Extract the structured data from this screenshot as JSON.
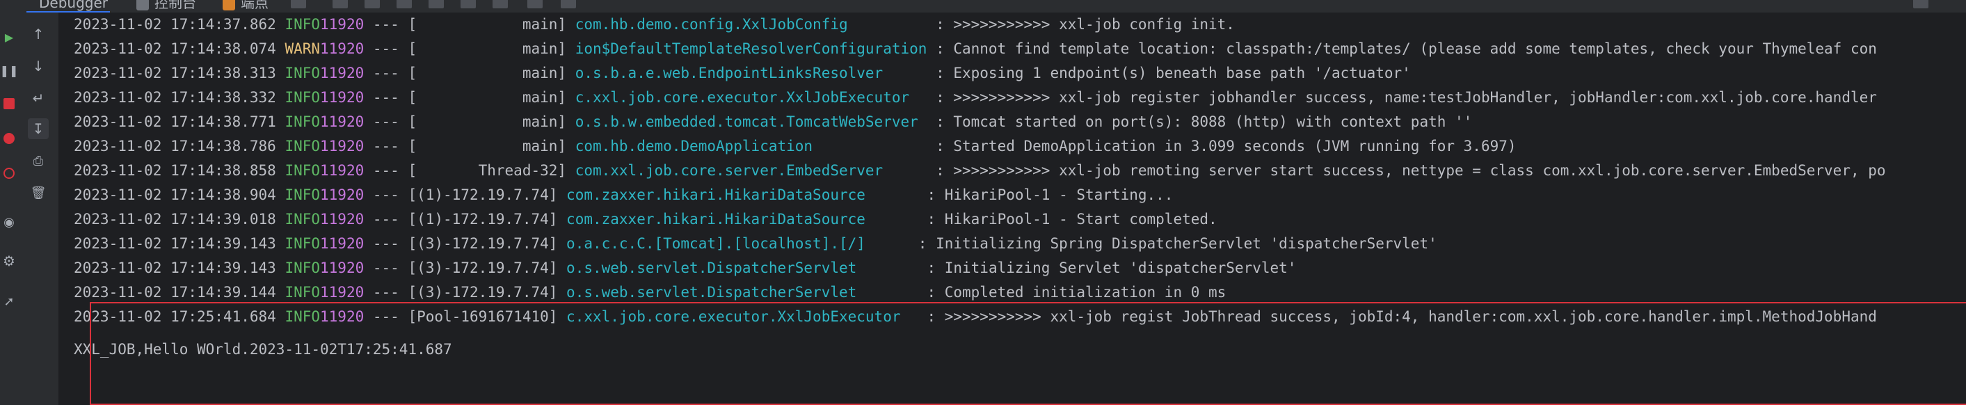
{
  "tabs": [
    {
      "label": "Debugger"
    },
    {
      "label": "控制台"
    },
    {
      "label": "端点"
    }
  ],
  "colors": {
    "info": "#5fb865",
    "warn": "#e5c07b",
    "pid": "#c678dd",
    "logger": "#2fb5c4",
    "highlight_border": "#d8323c"
  },
  "console": {
    "lines": [
      {
        "ts": "2023-11-02 17:14:37.862",
        "level": " INFO",
        "pid": "11920",
        "dash": " --- ",
        "thread": "[            main]",
        "logger": "com.hb.demo.config.XxlJobConfig         ",
        "msg": ": >>>>>>>>>>> xxl-job config init."
      },
      {
        "ts": "2023-11-02 17:14:38.074",
        "level": " WARN",
        "pid": "11920",
        "dash": " --- ",
        "thread": "[            main]",
        "logger": "ion$DefaultTemplateResolverConfiguration",
        "msg": ": Cannot find template location: classpath:/templates/ (please add some templates, check your Thymeleaf con"
      },
      {
        "ts": "2023-11-02 17:14:38.313",
        "level": " INFO",
        "pid": "11920",
        "dash": " --- ",
        "thread": "[            main]",
        "logger": "o.s.b.a.e.web.EndpointLinksResolver     ",
        "msg": ": Exposing 1 endpoint(s) beneath base path '/actuator'"
      },
      {
        "ts": "2023-11-02 17:14:38.332",
        "level": " INFO",
        "pid": "11920",
        "dash": " --- ",
        "thread": "[            main]",
        "logger": "c.xxl.job.core.executor.XxlJobExecutor  ",
        "msg": ": >>>>>>>>>>> xxl-job register jobhandler success, name:testJobHandler, jobHandler:com.xxl.job.core.handler"
      },
      {
        "ts": "2023-11-02 17:14:38.771",
        "level": " INFO",
        "pid": "11920",
        "dash": " --- ",
        "thread": "[            main]",
        "logger": "o.s.b.w.embedded.tomcat.TomcatWebServer ",
        "msg": ": Tomcat started on port(s): 8088 (http) with context path ''"
      },
      {
        "ts": "2023-11-02 17:14:38.786",
        "level": " INFO",
        "pid": "11920",
        "dash": " --- ",
        "thread": "[            main]",
        "logger": "com.hb.demo.DemoApplication             ",
        "msg": ": Started DemoApplication in 3.099 seconds (JVM running for 3.697)"
      },
      {
        "ts": "2023-11-02 17:14:38.858",
        "level": " INFO",
        "pid": "11920",
        "dash": " --- ",
        "thread": "[       Thread-32]",
        "logger": "com.xxl.job.core.server.EmbedServer     ",
        "msg": ": >>>>>>>>>>> xxl-job remoting server start success, nettype = class com.xxl.job.core.server.EmbedServer, po"
      },
      {
        "ts": "2023-11-02 17:14:38.904",
        "level": " INFO",
        "pid": "11920",
        "dash": " --- ",
        "thread": "[(1)-172.19.7.74]",
        "logger": "com.zaxxer.hikari.HikariDataSource      ",
        "msg": ": HikariPool-1 - Starting..."
      },
      {
        "ts": "2023-11-02 17:14:39.018",
        "level": " INFO",
        "pid": "11920",
        "dash": " --- ",
        "thread": "[(1)-172.19.7.74]",
        "logger": "com.zaxxer.hikari.HikariDataSource      ",
        "msg": ": HikariPool-1 - Start completed."
      },
      {
        "ts": "2023-11-02 17:14:39.143",
        "level": " INFO",
        "pid": "11920",
        "dash": " --- ",
        "thread": "[(3)-172.19.7.74]",
        "logger": "o.a.c.c.C.[Tomcat].[localhost].[/]     ",
        "msg": ": Initializing Spring DispatcherServlet 'dispatcherServlet'"
      },
      {
        "ts": "2023-11-02 17:14:39.143",
        "level": " INFO",
        "pid": "11920",
        "dash": " --- ",
        "thread": "[(3)-172.19.7.74]",
        "logger": "o.s.web.servlet.DispatcherServlet       ",
        "msg": ": Initializing Servlet 'dispatcherServlet'"
      },
      {
        "ts": "2023-11-02 17:14:39.144",
        "level": " INFO",
        "pid": "11920",
        "dash": " --- ",
        "thread": "[(3)-172.19.7.74]",
        "logger": "o.s.web.servlet.DispatcherServlet       ",
        "msg": ": Completed initialization in 0 ms"
      },
      {
        "ts": "2023-11-02 17:25:41.684",
        "level": " INFO",
        "pid": "11920",
        "dash": " --- ",
        "thread": "[Pool-1691671410]",
        "logger": "c.xxl.job.core.executor.XxlJobExecutor  ",
        "msg": ": >>>>>>>>>>> xxl-job regist JobThread success, jobId:4, handler:com.xxl.job.core.handler.impl.MethodJobHand"
      }
    ],
    "plain_line": "XXL_JOB,Hello WOrld.2023-11-02T17:25:41.687"
  }
}
